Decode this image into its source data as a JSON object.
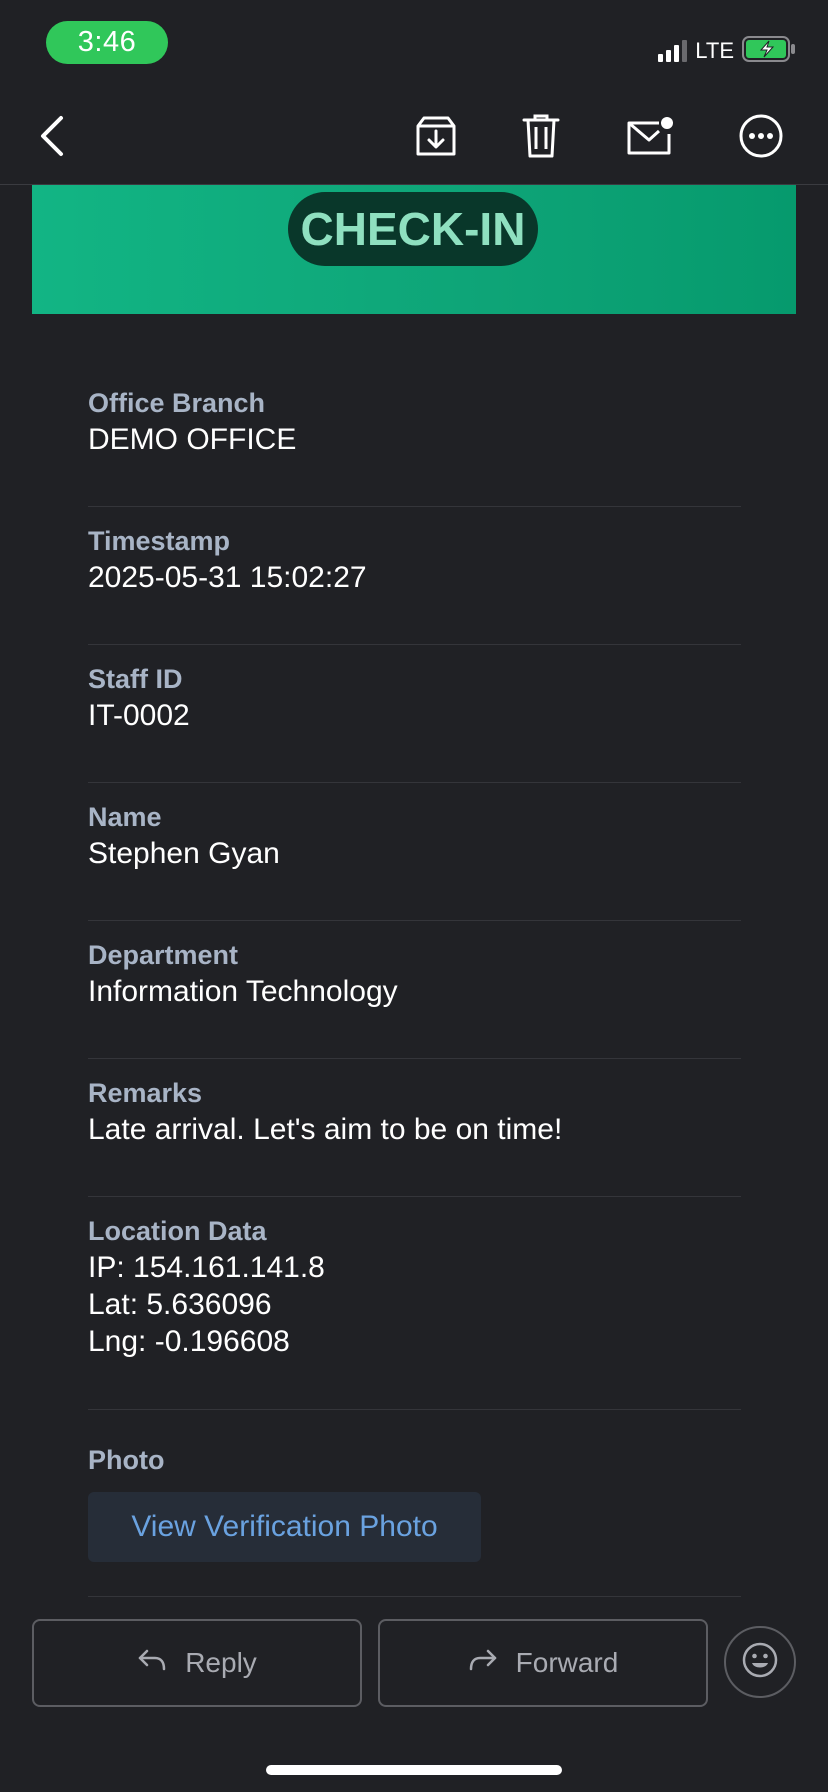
{
  "status_bar": {
    "time": "3:46",
    "network": "LTE"
  },
  "toolbar": {
    "back_icon": "chevron-left-icon",
    "archive_icon": "archive-download-icon",
    "trash_icon": "trash-icon",
    "unread_icon": "mail-unread-icon",
    "more_icon": "more-ellipsis-icon"
  },
  "banner": {
    "badge": "CHECK-IN",
    "color": "#12b584"
  },
  "fields": [
    {
      "label": "Office Branch",
      "value": "DEMO OFFICE"
    },
    {
      "label": "Timestamp",
      "value": "2025-05-31 15:02:27"
    },
    {
      "label": "Staff ID",
      "value": "IT-0002"
    },
    {
      "label": "Name",
      "value": "Stephen Gyan"
    },
    {
      "label": "Department",
      "value": "Information Technology"
    },
    {
      "label": "Remarks",
      "value": "Late arrival. Let's aim to be on time!"
    }
  ],
  "location": {
    "label": "Location Data",
    "ip": "IP: 154.161.141.8",
    "lat": "Lat: 5.636096",
    "lng": "Lng: -0.196608"
  },
  "photo": {
    "label": "Photo",
    "button": "View Verification Photo"
  },
  "actions": {
    "reply": "Reply",
    "forward": "Forward",
    "emoji_icon": "smiley-icon"
  },
  "colors": {
    "background": "#202125",
    "accent_link": "#6aa2e0",
    "status_green": "#30c75a"
  }
}
